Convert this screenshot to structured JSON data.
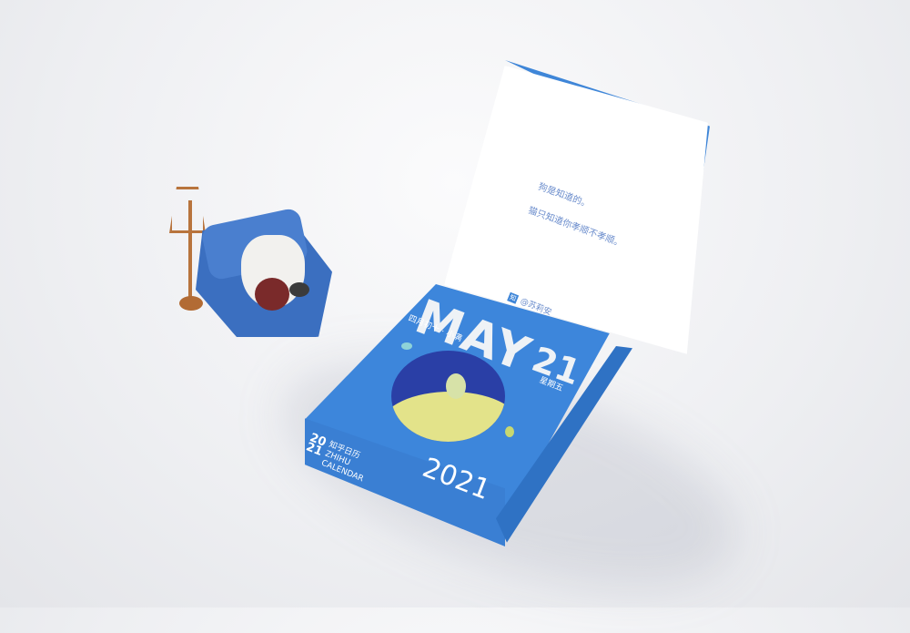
{
  "calendar": {
    "quote_lines": [
      "狗是知道的。",
      "猫只知道你孝顺不孝顺。"
    ],
    "author": "@苏莉安",
    "author_icon": "zhihu-icon",
    "month": "MAY",
    "lunar_date": "四月初十 · 小满",
    "day": "21",
    "weekday": "星期五",
    "year": "2021",
    "brand_year_top": "20",
    "brand_year_bottom": "21",
    "brand_cn": "知乎日历",
    "brand_pinyin": "ZHIHU",
    "brand_en": "CALENDAR",
    "colors": {
      "box": "#3d86db",
      "moon": "#2a3fa6",
      "yellow": "#e3e38a"
    }
  }
}
